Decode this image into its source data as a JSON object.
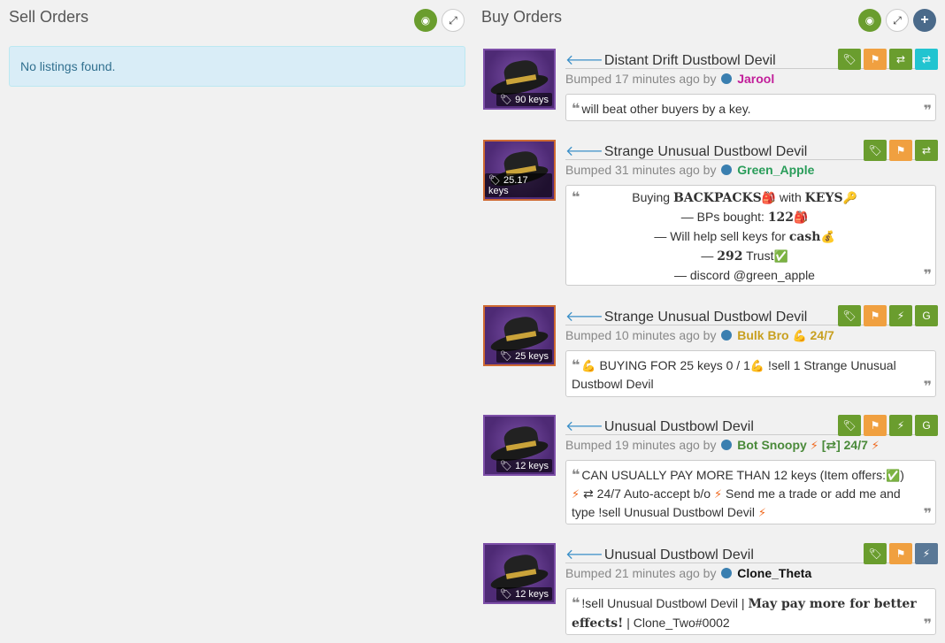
{
  "sell": {
    "title": "Sell Orders",
    "empty": "No listings found."
  },
  "buy": {
    "title": "Buy Orders"
  },
  "listings": [
    {
      "name": "Distant Drift Dustbowl Devil",
      "price": "90 keys",
      "bumped_prefix": "Bumped 17 minutes ago by",
      "user": "Jarool",
      "user_color": "#c21f9a",
      "comment": "will beat other buyers by a key."
    },
    {
      "name": "Strange Unusual Dustbowl Devil",
      "price": "25.17 keys",
      "bumped_prefix": "Bumped 31 minutes ago by",
      "user": "Green_Apple",
      "user_color": "#2a9d5a",
      "comment_lines": {
        "l1_a": "Buying ",
        "l1_b": "BACKPACKS",
        "l1_c": " with ",
        "l1_d": "KEYS",
        "l2_a": "— BPs bought: ",
        "l2_b": "122",
        "l3_a": "— Will help sell keys for ",
        "l3_b": "cash",
        "l4_a": "— ",
        "l4_b": "292",
        "l4_c": " Trust",
        "l5": "— discord @green_apple"
      }
    },
    {
      "name": "Strange Unusual Dustbowl Devil",
      "price": "25 keys",
      "bumped_prefix": "Bumped 10 minutes ago by",
      "user": "Bulk Bro",
      "user_suffix": "24/7",
      "user_color": "#c8a020",
      "comment": "BUYING FOR 25 keys 0 / 1",
      "comment_b": "!sell 1 Strange Unusual Dustbowl Devil"
    },
    {
      "name": "Unusual Dustbowl Devil",
      "price": "12 keys",
      "bumped_prefix": "Bumped 19 minutes ago by",
      "user": "Bot Snoopy",
      "user_mid": "[⇄] 24/7",
      "user_color": "#4a8a3a",
      "comment_a": "CAN USUALLY PAY MORE THAN 12 keys (Item offers:",
      "comment_b": ")",
      "comment_c": "⇄ 24/7 Auto-accept b/o",
      "comment_d": "Send me a trade or add me and type !sell Unusual Dustbowl Devil"
    },
    {
      "name": "Unusual Dustbowl Devil",
      "price": "12 keys",
      "bumped_prefix": "Bumped 21 minutes ago by",
      "user": "Clone_Theta",
      "user_color": "#111111",
      "comment_a": "!sell Unusual Dustbowl Devil | ",
      "comment_b": "May pay more for better effects!",
      "comment_c": " | Clone_Two#0002"
    }
  ]
}
